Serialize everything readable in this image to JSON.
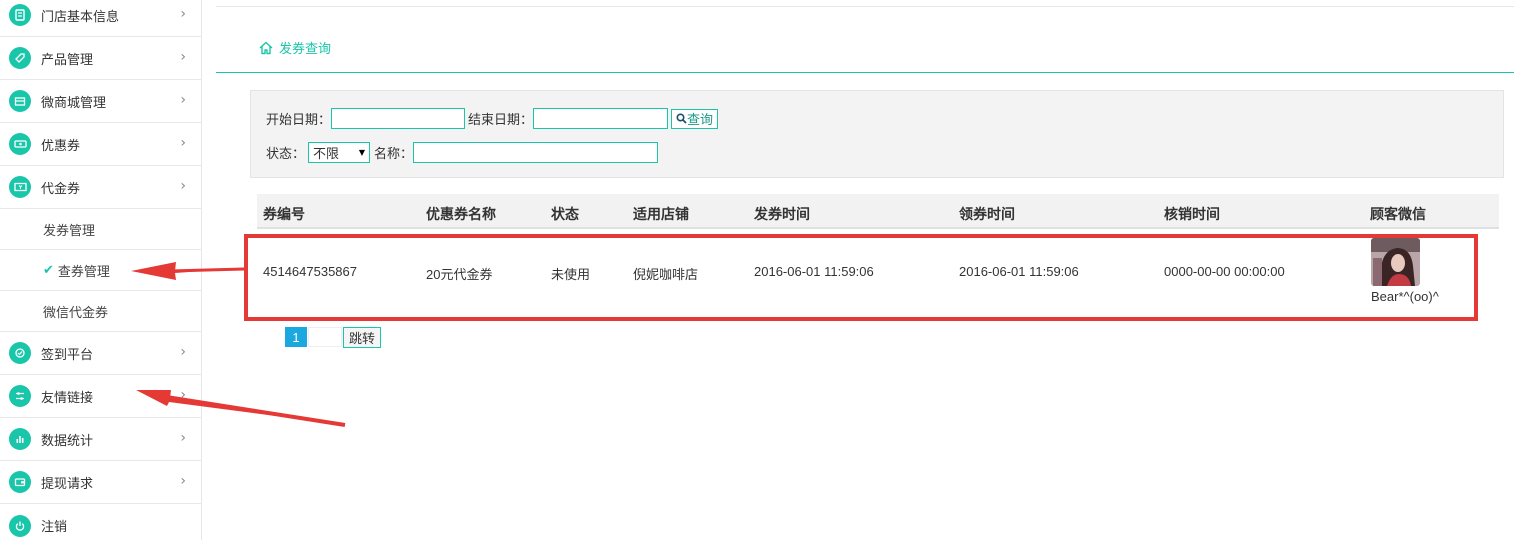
{
  "sidebar": {
    "items": [
      {
        "label": "门店基本信息",
        "icon": "document-icon"
      },
      {
        "label": "产品管理",
        "icon": "tag-icon"
      },
      {
        "label": "微商城管理",
        "icon": "store-icon"
      },
      {
        "label": "优惠券",
        "icon": "ticket-icon"
      },
      {
        "label": "代金券",
        "icon": "voucher-icon"
      }
    ],
    "sub_items": [
      {
        "label": "发券管理"
      },
      {
        "label": "查券管理"
      },
      {
        "label": "微信代金券"
      }
    ],
    "items_after": [
      {
        "label": "签到平台",
        "icon": "checkin-icon"
      },
      {
        "label": "友情链接",
        "icon": "sliders-icon"
      },
      {
        "label": "数据统计",
        "icon": "chart-icon"
      },
      {
        "label": "提现请求",
        "icon": "wallet-icon"
      },
      {
        "label": "注销",
        "icon": "power-icon"
      }
    ],
    "chevron": "›",
    "check": "✔"
  },
  "breadcrumb": {
    "label": "发券查询",
    "icon": "home-icon"
  },
  "filter": {
    "start_label": "开始日期：",
    "end_label": "结束日期：",
    "query_button": "查询",
    "status_label": "状态：",
    "status_value": "不限",
    "name_label": "名称：",
    "start_value": "",
    "end_value": "",
    "name_value": ""
  },
  "table": {
    "headers": [
      "券编号",
      "优惠券名称",
      "状态",
      "适用店铺",
      "发券时间",
      "领券时间",
      "核销时间",
      "顾客微信"
    ],
    "rows": [
      {
        "code": "4514647535867",
        "name": "20元代金券",
        "status": "未使用",
        "store": "倪妮咖啡店",
        "issue_time": "2016-06-01 11:59:06",
        "claim_time": "2016-06-01 11:59:06",
        "verify_time": "0000-00-00 00:00:00",
        "wechat_name": "Bear*^(oo)^"
      }
    ]
  },
  "pagination": {
    "current": "1",
    "jump_label": "跳转"
  },
  "colors": {
    "accent": "#19c6a9",
    "annotation": "#e53935",
    "page_active": "#1ba8e0"
  }
}
